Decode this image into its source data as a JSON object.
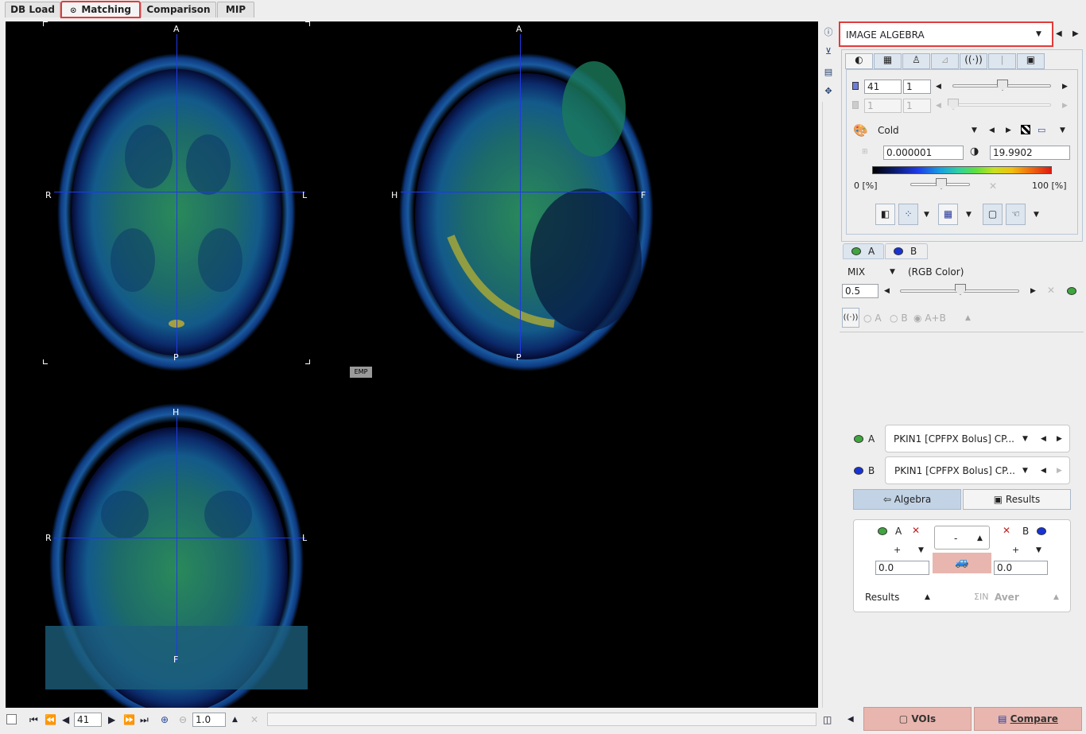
{
  "tabs": [
    {
      "label": "DB Load"
    },
    {
      "label": "Matching"
    },
    {
      "label": "Comparison"
    },
    {
      "label": "MIP"
    }
  ],
  "viewer": {
    "axial": {
      "top": "A",
      "bottom": "P",
      "left": "R",
      "right": "L"
    },
    "sagittal": {
      "top": "A",
      "bottom": "P",
      "left": "H",
      "right": "F"
    },
    "coronal": {
      "top": "H",
      "bottom": "F",
      "left": "R",
      "right": "L"
    },
    "emp_label": "EMP"
  },
  "tool_select": {
    "value": "IMAGE ALGEBRA"
  },
  "display": {
    "slice_value": "41",
    "slice_step": "1",
    "frame_value": "1",
    "frame_step": "1",
    "colormap": "Cold",
    "min_value": "0.000001",
    "max_value": "19.9902",
    "percent_min": "0 [%]",
    "percent_max": "100 [%]"
  },
  "ab_tabs": [
    {
      "label": "A"
    },
    {
      "label": "B"
    }
  ],
  "mix": {
    "mode": "MIX",
    "mode_desc": "(RGB Color)",
    "value": "0.5",
    "radio_a": "A",
    "radio_b": "B",
    "radio_ab": "A+B"
  },
  "series": {
    "a_label": "A",
    "a_value": "PKIN1 [CPFPX Bolus] CP...",
    "b_label": "B",
    "b_value": "PKIN1 [CPFPX Bolus] CP..."
  },
  "algebra": {
    "tab_algebra": "Algebra",
    "tab_results": "Results",
    "a_label": "A",
    "b_label": "B",
    "operator": "-",
    "a_sign": "+",
    "b_sign": "+",
    "a_const": "0.0",
    "b_const": "0.0",
    "results_label": "Results",
    "aver_label": "Aver",
    "sum_label": "ΣIN"
  },
  "bottom": {
    "slice_value": "41",
    "zoom_value": "1.0",
    "vois_label": "VOIs",
    "compare_label": "Compare"
  },
  "colors": {
    "accent_red": "#e23b3b",
    "crosshair": "#1f3ae6",
    "a_dot": "#2e9a2e",
    "b_dot": "#1733d6",
    "pink_button": "#e8b6ae"
  }
}
